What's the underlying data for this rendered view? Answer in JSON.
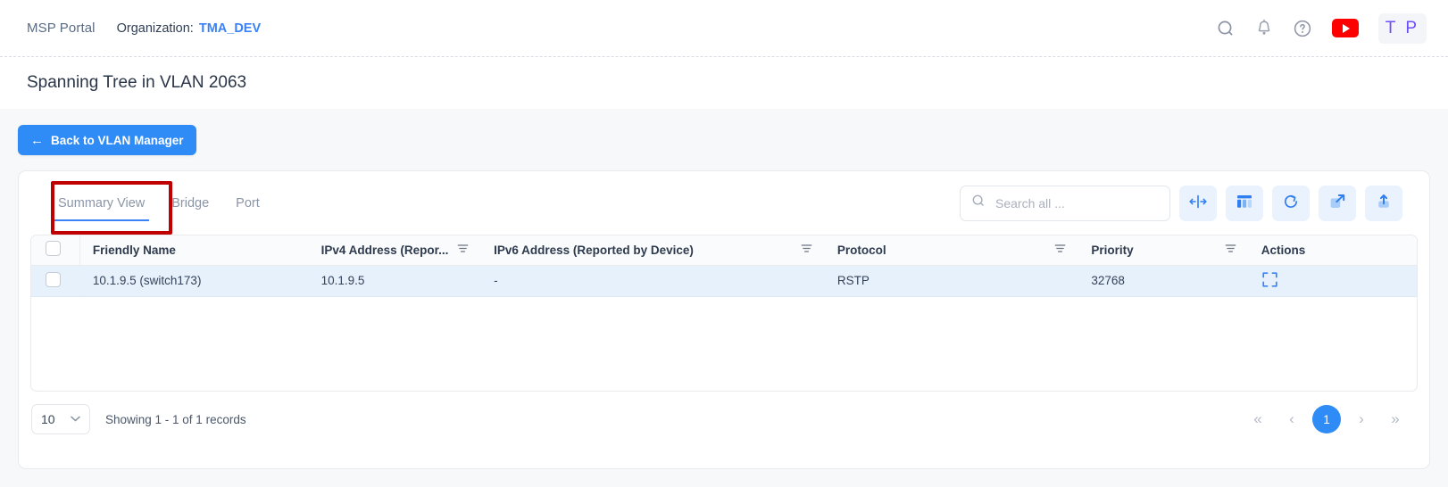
{
  "topbar": {
    "brand": "MSP Portal",
    "org_label": "Organization:",
    "org_value": "TMA_DEV",
    "icons": [
      "search-icon",
      "bell-icon",
      "help-icon",
      "youtube-icon"
    ],
    "avatar_initials": "T P"
  },
  "page": {
    "title": "Spanning Tree in VLAN 2063",
    "back_button": "Back to VLAN Manager",
    "back_arrow": "←"
  },
  "tabs": [
    {
      "label": "Summary View",
      "active": true
    },
    {
      "label": "Bridge",
      "active": false
    },
    {
      "label": "Port",
      "active": false
    }
  ],
  "toolbar": {
    "search_placeholder": "Search all ...",
    "search_value": "",
    "buttons": [
      {
        "name": "fit-columns-icon",
        "title": "Fit columns"
      },
      {
        "name": "column-chooser-icon",
        "title": "Column chooser"
      },
      {
        "name": "refresh-icon",
        "title": "Refresh"
      },
      {
        "name": "fullscreen-icon",
        "title": "Expand"
      },
      {
        "name": "export-icon",
        "title": "Export"
      }
    ]
  },
  "table": {
    "columns": [
      {
        "label": "Friendly Name",
        "filter": false
      },
      {
        "label": "IPv4 Address (Repor...",
        "filter": true
      },
      {
        "label": "IPv6 Address (Reported by Device)",
        "filter": true
      },
      {
        "label": "Protocol",
        "filter": true
      },
      {
        "label": "Priority",
        "filter": true
      },
      {
        "label": "Actions",
        "filter": false
      }
    ],
    "rows": [
      {
        "friendly_name": "10.1.9.5 (switch173)",
        "ipv4": "10.1.9.5",
        "ipv6": "-",
        "protocol": "RSTP",
        "priority": "32768",
        "action_icon": "expand-icon"
      }
    ]
  },
  "footer": {
    "page_size": "10",
    "page_size_chevron": "⌄",
    "records": "Showing 1 - 1 of 1 records",
    "pager": {
      "first": "«",
      "prev": "‹",
      "current": "1",
      "next": "›",
      "last": "»"
    }
  },
  "colors": {
    "accent": "#2f8bf5",
    "link": "#3b82f6",
    "annotation": "#c00000",
    "row_highlight": "#e7f1fb",
    "avatar_text": "#6d4df6",
    "youtube": "#ff0000"
  }
}
